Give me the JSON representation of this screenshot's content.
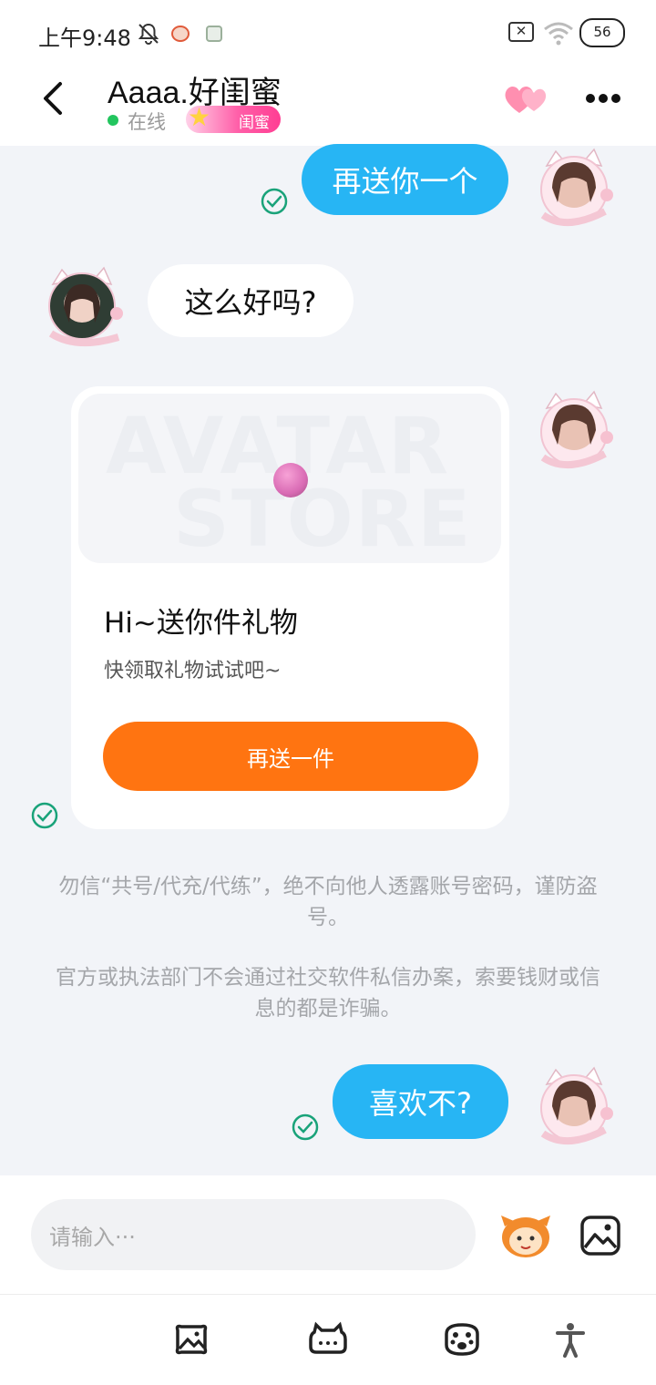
{
  "status_bar": {
    "time": "上午9:48",
    "battery": "56",
    "icons": [
      "bell-off-icon",
      "app-notification-icon",
      "app-notification-icon",
      "sim-x-icon",
      "wifi-icon",
      "battery-icon"
    ]
  },
  "header": {
    "title": "Aaaa.好闺蜜",
    "status": "在线",
    "relation_badge": "闺蜜",
    "icons": [
      "back-icon",
      "hearts-icon",
      "more-icon"
    ]
  },
  "messages": [
    {
      "direction": "out",
      "text": "再送你一个",
      "read": true
    },
    {
      "direction": "in",
      "text": "这么好吗?"
    },
    {
      "direction": "out",
      "type": "gift_card",
      "card_title": "Hi~送你件礼物",
      "card_subtitle": "快领取礼物试试吧~",
      "card_button": "再送一件",
      "watermark_line1": "AVATAR",
      "watermark_line2": "STORE",
      "read": true
    },
    {
      "direction": "out",
      "text": "喜欢不?",
      "read": true
    }
  ],
  "notices": [
    "勿信“共号/代充/代练”，绝不向他人透露账号密码，谨防盗号。",
    "官方或执法部门不会通过社交软件私信办案，索要钱财或信息的都是诈骗。"
  ],
  "input": {
    "placeholder": "请输入···",
    "icons": [
      "emoji-icon",
      "image-icon"
    ]
  },
  "bottom_nav": {
    "icons": [
      "album-icon",
      "chat-bubble-icon",
      "paw-icon",
      "accessibility-icon"
    ]
  },
  "colors": {
    "bubble_out": "#27b5f4",
    "bubble_in": "#ffffff",
    "card_button": "#ff7411",
    "background": "#f2f4f8",
    "online": "#22c55e",
    "read_check": "#1aa37a",
    "badge": "#ff4f9f"
  }
}
